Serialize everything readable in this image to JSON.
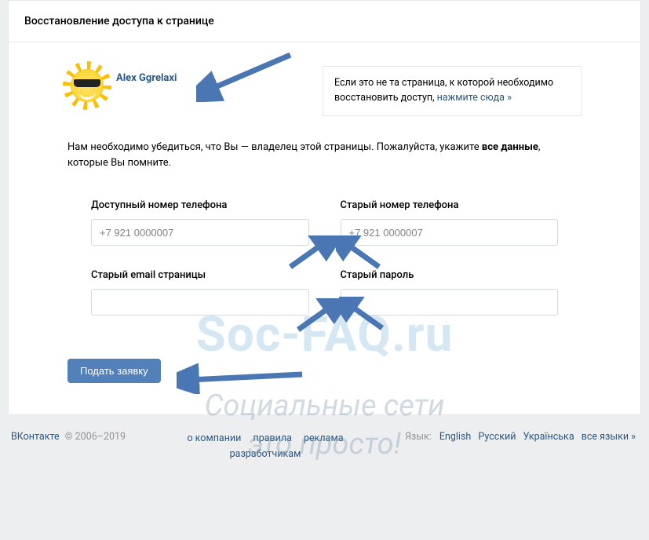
{
  "header": {
    "title": "Восстановление доступа к странице"
  },
  "profile": {
    "name": "Alex Ggrelaxi"
  },
  "infobox": {
    "text": "Если это не та страница, к которой необходимо восстановить доступ, ",
    "link": "нажмите сюда »"
  },
  "instructions": {
    "pre": "Нам необходимо убедиться, что Вы — владелец этой страницы. Пожалуйста, укажите ",
    "bold": "все данные",
    "post": ", которые Вы помните."
  },
  "fields": {
    "available_phone": {
      "label": "Доступный номер телефона",
      "placeholder": "+7 921 0000007"
    },
    "old_phone": {
      "label": "Старый номер телефона",
      "placeholder": "+7 921 0000007"
    },
    "old_email": {
      "label": "Старый email страницы",
      "placeholder": ""
    },
    "old_password": {
      "label": "Старый пароль",
      "placeholder": ""
    }
  },
  "submit": {
    "label": "Подать заявку"
  },
  "footer": {
    "brand": "ВКонтакте",
    "copyright": "© 2006–2019",
    "links": {
      "about": "о компании",
      "rules": "правила",
      "ads": "реклама",
      "devs": "разработчикам"
    },
    "lang_label": "Язык:",
    "langs": {
      "en": "English",
      "ru": "Русский",
      "uk": "Українська",
      "all": "все языки »"
    }
  },
  "watermark": {
    "line1": "Soc-FAQ.ru",
    "line2a": "Социальные сети",
    "line2b": "это просто!"
  }
}
